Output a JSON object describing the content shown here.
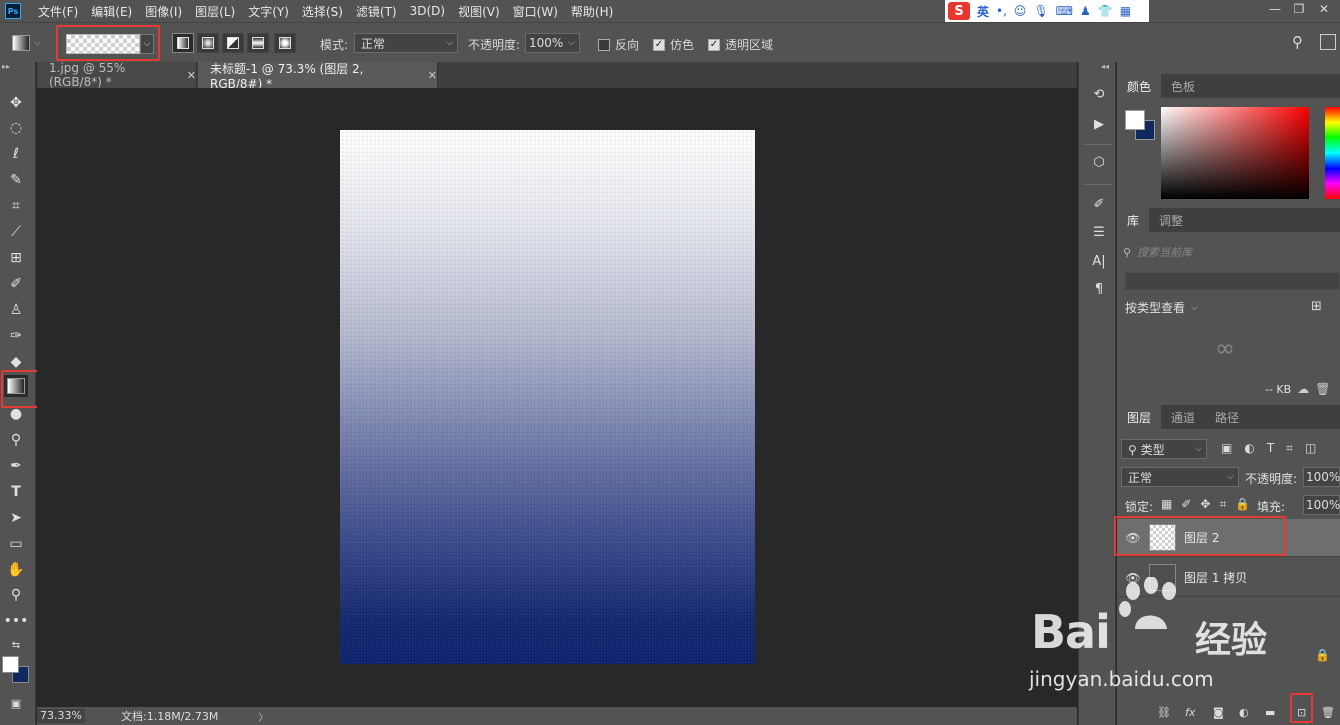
{
  "menubar": {
    "app_badge": "Ps",
    "items": [
      "文件(F)",
      "编辑(E)",
      "图像(I)",
      "图层(L)",
      "文字(Y)",
      "选择(S)",
      "滤镜(T)",
      "3D(D)",
      "视图(V)",
      "窗口(W)",
      "帮助(H)"
    ],
    "ime": {
      "logo": "S",
      "lang": "英"
    }
  },
  "options": {
    "mode_label": "模式:",
    "mode_value": "正常",
    "opacity_label": "不透明度:",
    "opacity_value": "100%",
    "reverse_label": "反向",
    "dither_label": "仿色",
    "transparency_label": "透明区域",
    "reverse_checked": false,
    "dither_checked": true,
    "transparency_checked": true
  },
  "tabs": [
    {
      "label": "1.jpg @ 55%(RGB/8*) *",
      "active": false
    },
    {
      "label": "未标题-1 @ 73.3% (图层 2, RGB/8#) *",
      "active": true
    }
  ],
  "canvas": {
    "gradient_top": "#ffffff",
    "gradient_bottom": "#0d2270"
  },
  "statusbar": {
    "zoom": "73.33%",
    "doc_info": "文档:1.18M/2.73M"
  },
  "color_panel": {
    "tabs": [
      "颜色",
      "色板"
    ],
    "fg_color": "#ffffff",
    "bg_color": "#0f2a5e"
  },
  "library_panel": {
    "tabs": [
      "库",
      "调整"
    ],
    "search_placeholder": "搜索当前库",
    "view_by": "按类型查看",
    "size": "-- KB"
  },
  "layers_panel": {
    "tabs": [
      "图层",
      "通道",
      "路径"
    ],
    "filter_kind": "类型",
    "blend_mode": "正常",
    "opacity_label": "不透明度:",
    "opacity_value": "100%",
    "lock_label": "锁定:",
    "fill_label": "填充:",
    "fill_value": "100%",
    "layers": [
      {
        "name": "图层 2",
        "selected": true
      },
      {
        "name": "图层 1 拷贝",
        "selected": false
      }
    ]
  },
  "watermark": {
    "brand": "Bai",
    "brand_cn": "经验",
    "url": "jingyan.baidu.com"
  }
}
